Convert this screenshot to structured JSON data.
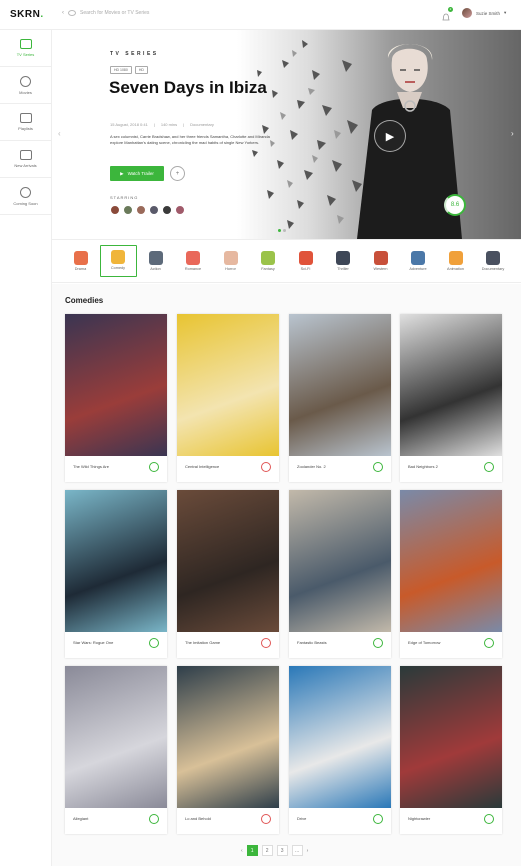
{
  "header": {
    "logo_text": "SKRN",
    "search_placeholder": "Search for Movies or TV Series",
    "notification_count": "2",
    "user_name": "Suzie Smith"
  },
  "sidebar": {
    "items": [
      {
        "label": "TV Series",
        "active": true
      },
      {
        "label": "Movies"
      },
      {
        "label": "Playlists"
      },
      {
        "label": "New Arrivals"
      },
      {
        "label": "Coming Soon"
      }
    ]
  },
  "hero": {
    "subtitle": "TV SERIES",
    "tags": [
      "HD 1080",
      "HD"
    ],
    "title": "Seven Days in Ibiza",
    "date": "15 August, 2018 0:41",
    "runtime": "140 mins",
    "genre": "Documentary",
    "description": "A sex columnist, Carrie Bradshaw, and her three friends Samantha, Charlotte and Miranda explore Manhattan's dating scene, chronicling the mad habits of single New Yorkers.",
    "watch_label": "Watch Trailer",
    "plus_label": "+",
    "starring_label": "STARRING",
    "rating": "8.6"
  },
  "genres": [
    {
      "label": "Drama",
      "color": "#e8704a"
    },
    {
      "label": "Comedy",
      "color": "#f0b53a",
      "active": true
    },
    {
      "label": "Action",
      "color": "#5d6a7a"
    },
    {
      "label": "Romance",
      "color": "#e9685a"
    },
    {
      "label": "Horror",
      "color": "#e6b8a0"
    },
    {
      "label": "Fantasy",
      "color": "#9bc34a"
    },
    {
      "label": "Sci-Fi",
      "color": "#e0533a"
    },
    {
      "label": "Thriller",
      "color": "#3e4757"
    },
    {
      "label": "Western",
      "color": "#c8503a"
    },
    {
      "label": "Adventure",
      "color": "#4b78a8"
    },
    {
      "label": "Animation",
      "color": "#f0a03a"
    },
    {
      "label": "Documentary",
      "color": "#4a5160"
    }
  ],
  "section": {
    "title": "Comedies"
  },
  "movies": [
    {
      "title": "The Wild Things Are",
      "poster": [
        "#3a3552",
        "#9a3d3a"
      ],
      "ring": "green"
    },
    {
      "title": "Central Intelligence",
      "poster": [
        "#e8c431",
        "#f3e4b0"
      ],
      "ring": "red"
    },
    {
      "title": "Zoolander No. 2",
      "poster": [
        "#b9c4cf",
        "#6a5a4a"
      ],
      "ring": "green"
    },
    {
      "title": "Bad Neighbors 2",
      "poster": [
        "#e0e0e0",
        "#333333"
      ],
      "ring": "green"
    },
    {
      "title": "Star Wars: Rogue One",
      "poster": [
        "#7ab6c8",
        "#1e2a36"
      ],
      "ring": "green"
    },
    {
      "title": "The Imitation Game",
      "poster": [
        "#6a4b3a",
        "#2e2622"
      ],
      "ring": "red"
    },
    {
      "title": "Fantastic Beasts",
      "poster": [
        "#c2b9aa",
        "#4a5a6a"
      ],
      "ring": "green"
    },
    {
      "title": "Edge of Tomorrow",
      "poster": [
        "#7a8aa8",
        "#c85a2a"
      ],
      "ring": "green"
    },
    {
      "title": "Allegiant",
      "poster": [
        "#8a8a98",
        "#d6d6dc"
      ],
      "ring": "green"
    },
    {
      "title": "Lo and Behold",
      "poster": [
        "#2e3e4a",
        "#d8c098"
      ],
      "ring": "red"
    },
    {
      "title": "Drive",
      "poster": [
        "#2a78b8",
        "#e8e8e8"
      ],
      "ring": "green"
    },
    {
      "title": "Nightcrawler",
      "poster": [
        "#2a3a3a",
        "#a03a3a"
      ],
      "ring": "green"
    }
  ],
  "pagination": {
    "prev": "‹",
    "pages": [
      "1",
      "2",
      "3",
      "…"
    ],
    "next": "›"
  }
}
